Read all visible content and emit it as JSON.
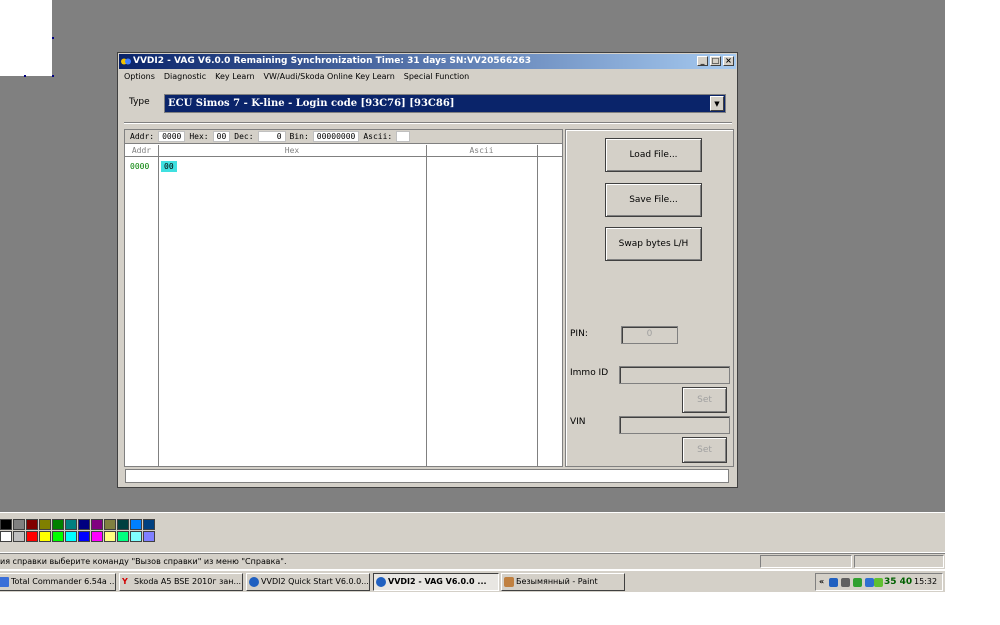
{
  "window": {
    "title": "VVDI2 - VAG V6.0.0     Remaining Synchronization Time: 31 days     SN:VV20566263",
    "min": "_",
    "max": "□",
    "close": "×"
  },
  "menu": [
    "Options",
    "Diagnostic",
    "Key Learn",
    "VW/Audi/Skoda Online Key Learn",
    "Special Function"
  ],
  "type": {
    "label": "Type",
    "selected": "ECU Simos 7 - K-line - Login code [93C76] [93C86]",
    "arrow": "▼"
  },
  "hex_editor": {
    "addr_label": "Addr:",
    "addr_value": "0000",
    "hex_label": "Hex:",
    "hex_value": "00",
    "dec_label": "Dec:",
    "dec_value": "0",
    "bin_label": "Bin:",
    "bin_value": "00000000",
    "ascii_label": "Ascii:",
    "ascii_value": "",
    "col_addr": "Addr",
    "col_hex": "Hex",
    "col_ascii": "Ascii",
    "row_addr": "0000",
    "row_byte": "00"
  },
  "buttons": {
    "load": "Load File...",
    "save": "Save File...",
    "swap": "Swap bytes L/H",
    "set1": "Set",
    "set2": "Set"
  },
  "fields": {
    "pin_label": "PIN:",
    "pin_value": "0",
    "immo_label": "Immo ID",
    "vin_label": "VIN"
  },
  "palette_colors": [
    "#000000",
    "#808080",
    "#800000",
    "#808000",
    "#008000",
    "#008080",
    "#000080",
    "#800080",
    "#808040",
    "#004040",
    "#0080ff",
    "#004080",
    "#ffffff",
    "#c0c0c0",
    "#ff0000",
    "#ffff00",
    "#00ff00",
    "#00ffff",
    "#0000ff",
    "#ff00ff",
    "#ffff80",
    "#00ff80",
    "#80ffff",
    "#8080ff"
  ],
  "paint_status": "ия справки выберите команду \"Вызов справки\" из меню \"Справка\".",
  "taskbar": {
    "tasks": [
      {
        "label": "Total Commander 6.54a ...",
        "icon": "folder-icon",
        "color": "#3a6fd8"
      },
      {
        "label": "Skoda A5 BSE 2010г зан...",
        "icon": "yandex-icon",
        "color": "#d00000"
      },
      {
        "label": "VVDI2 Quick Start V6.0.0...",
        "icon": "vvdi-icon",
        "color": "#2060c0"
      },
      {
        "label": "VVDI2 - VAG V6.0.0    ...",
        "icon": "vvdi-icon",
        "color": "#2060c0"
      },
      {
        "label": "Безымянный - Paint",
        "icon": "paint-icon",
        "color": "#c08040"
      }
    ],
    "tray_chevron": "«",
    "tray_badge": "35 40",
    "clock": "15:32"
  }
}
